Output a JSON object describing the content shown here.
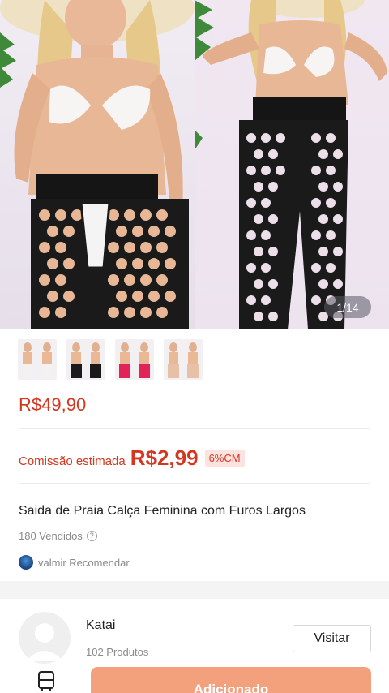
{
  "gallery": {
    "counter": "1/14",
    "thumbnails": [
      "thumb-1",
      "thumb-2",
      "thumb-3",
      "thumb-4"
    ]
  },
  "product": {
    "price": "R$49,90",
    "commission_label": "Comissão estimada",
    "commission_value": "R$2,99",
    "commission_badge": "6%CM",
    "title": "Saida de Praia Calça Feminina com Furos Largos",
    "sold": "180 Vendidos",
    "recommender": "valmir Recomendar"
  },
  "store": {
    "name": "Katai",
    "products": "102 Produtos",
    "visit_label": "Visitar"
  },
  "footer": {
    "add_label": "Adicionado"
  },
  "colors": {
    "accent_red": "#d4361f",
    "button_orange": "#f3a07d"
  }
}
